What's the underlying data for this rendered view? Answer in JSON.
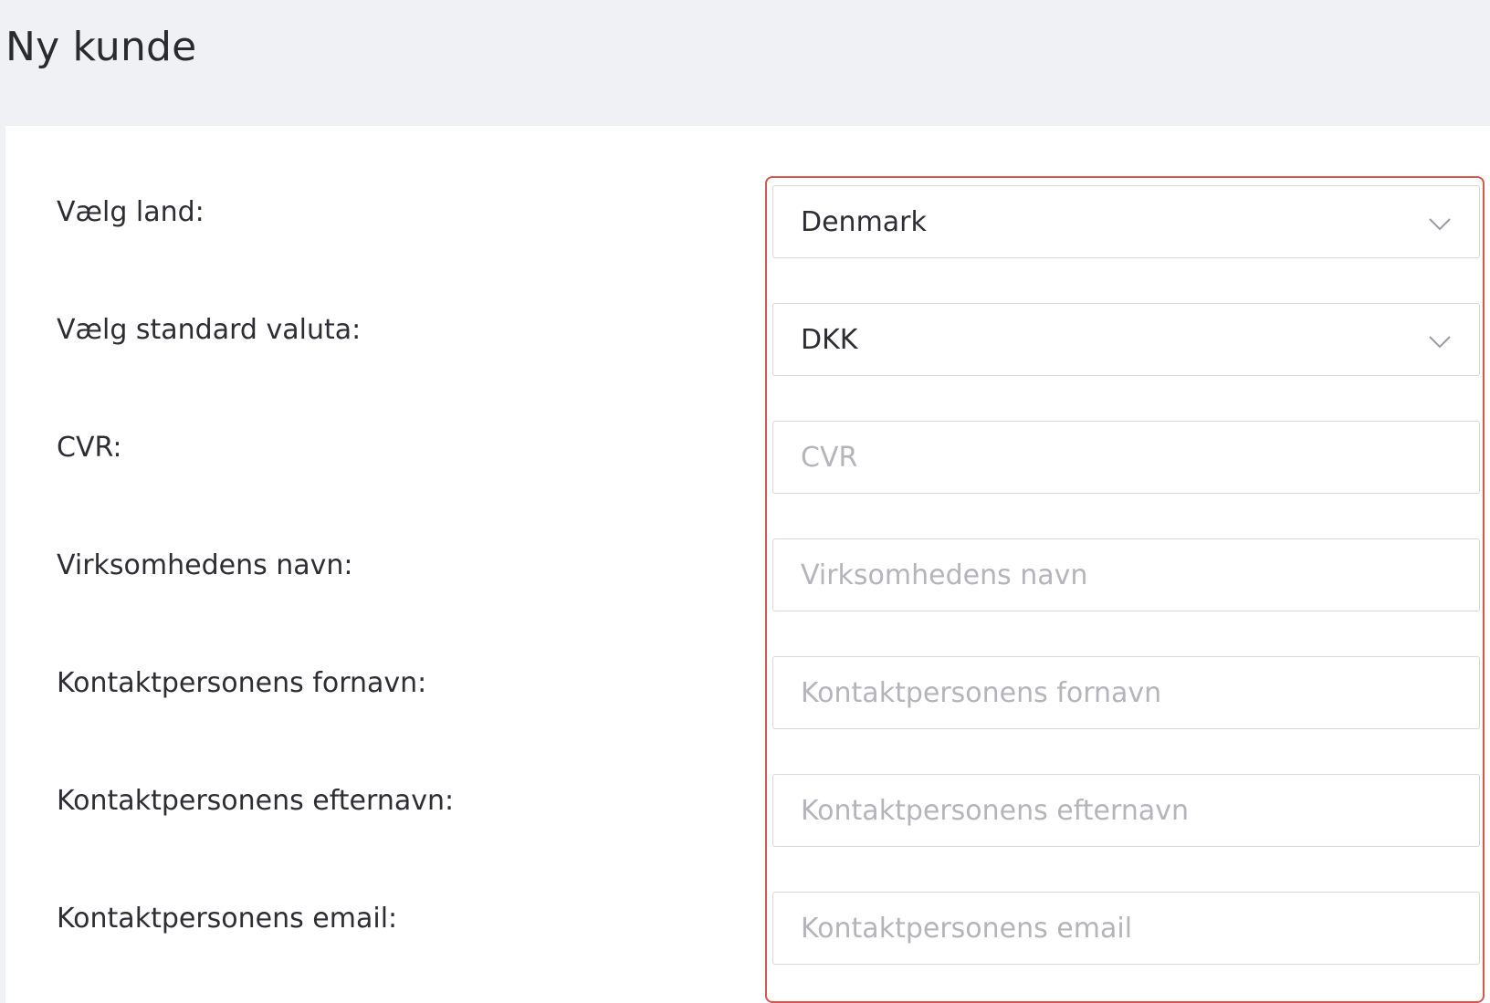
{
  "page": {
    "title": "Ny kunde"
  },
  "form": {
    "country": {
      "label": "Vælg land:",
      "value": "Denmark",
      "icon": "chevron-down-icon"
    },
    "currency": {
      "label": "Vælg standard valuta:",
      "value": "DKK",
      "icon": "chevron-down-icon"
    },
    "cvr": {
      "label": "CVR:",
      "placeholder": "CVR"
    },
    "company_name": {
      "label": "Virksomhedens navn:",
      "placeholder": "Virksomhedens navn"
    },
    "contact_first_name": {
      "label": "Kontaktpersonens fornavn:",
      "placeholder": "Kontaktpersonens fornavn"
    },
    "contact_last_name": {
      "label": "Kontaktpersonens efternavn:",
      "placeholder": "Kontaktpersonens efternavn"
    },
    "contact_email": {
      "label": "Kontaktpersonens email:",
      "placeholder": "Kontaktpersonens email"
    }
  },
  "colors": {
    "highlight_border": "#d9574a",
    "header_background": "#f0f1f4",
    "placeholder_text": "#b4b4ba"
  }
}
